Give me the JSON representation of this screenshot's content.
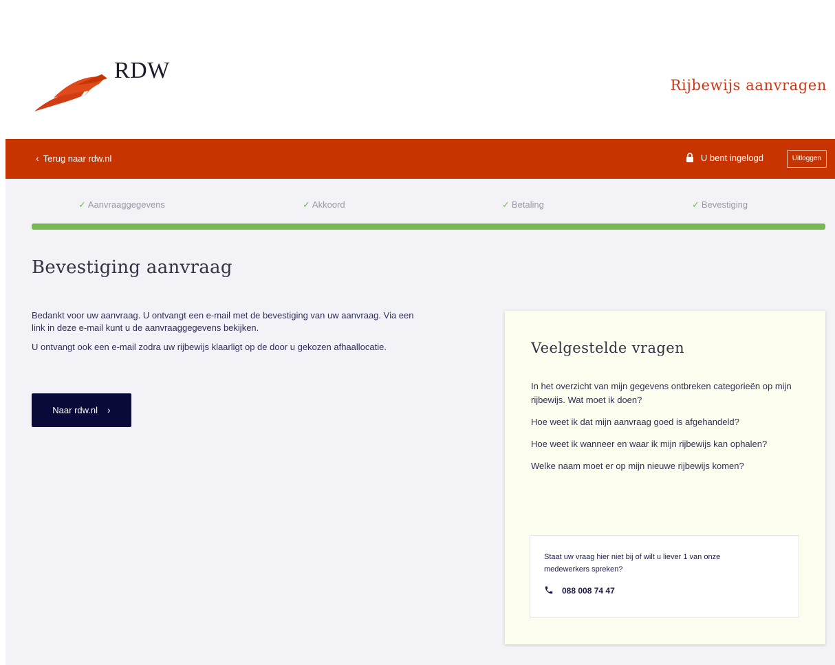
{
  "header": {
    "logo_text": "RDW",
    "app_title": "Rijbewijs aanvragen"
  },
  "navbar": {
    "back_label": "Terug naar rdw.nl",
    "login_status": "U bent ingelogd",
    "logout_label": "Uitloggen"
  },
  "steps": [
    {
      "label": "Aanvraaggegevens",
      "status": "completed"
    },
    {
      "label": "Akkoord",
      "status": "completed"
    },
    {
      "label": "Betaling",
      "status": "completed"
    },
    {
      "label": "Bevestiging",
      "status": "completed"
    }
  ],
  "progress": {
    "value": 1.0
  },
  "main": {
    "title": "Bevestiging aanvraag",
    "paragraphs": [
      "Bedankt voor uw aanvraag. U ontvangt een e-mail met de bevestiging van uw aanvraag. Via een link in deze e-mail kunt u de aanvraaggegevens bekijken.",
      "U ontvangt ook een e-mail zodra uw rijbewijs klaarligt op de door u gekozen afhaallocatie."
    ],
    "cta_label": "Naar rdw.nl"
  },
  "faq": {
    "title": "Veelgestelde vragen",
    "items": [
      "In het overzicht van mijn gegevens ontbreken categorieën op mijn rijbewijs. Wat moet ik doen?",
      "Hoe weet ik dat mijn aanvraag goed is afgehandeld?",
      "Hoe weet ik wanneer en waar ik mijn rijbewijs kan ophalen?",
      "Welke naam moet er op mijn nieuwe rijbewijs komen?"
    ],
    "contact": {
      "text": "Staat uw vraag hier niet bij of wilt u liever 1 van onze medewerkers spreken?",
      "phone": "088 008 74 47"
    }
  },
  "colors": {
    "brand": "#c83400",
    "progress": "#76b852",
    "button": "#0a0a3a",
    "faq_background": "#fefef0"
  },
  "icons": {
    "back": "chevron-left-icon",
    "lock": "lock-icon",
    "step_done": "check-icon",
    "cta": "chevron-right-icon",
    "phone": "phone-icon"
  }
}
